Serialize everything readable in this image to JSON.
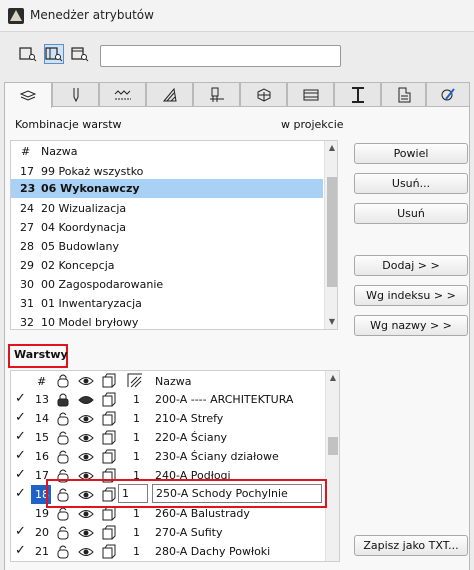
{
  "window": {
    "title": "Menedżer atrybutów"
  },
  "toolbar": {
    "buttons": [
      {
        "icon": "list-view-search-icon",
        "active": false
      },
      {
        "icon": "split-view-search-icon",
        "active": true
      },
      {
        "icon": "single-view-search-icon",
        "active": false
      }
    ],
    "search_value": ""
  },
  "tabs": [
    {
      "icon": "layers-tab-icon",
      "active": true
    },
    {
      "icon": "pens-tab-icon",
      "active": false
    },
    {
      "icon": "line-types-tab-icon",
      "active": false
    },
    {
      "icon": "fills-tab-icon",
      "active": false
    },
    {
      "icon": "surfaces-tab-icon",
      "active": false
    },
    {
      "icon": "building-materials-tab-icon",
      "active": false
    },
    {
      "icon": "composites-tab-icon",
      "active": false
    },
    {
      "icon": "profiles-tab-icon",
      "active": false
    },
    {
      "icon": "zone-categories-tab-icon",
      "active": false
    },
    {
      "icon": "markup-styles-tab-icon",
      "active": false
    }
  ],
  "combinations": {
    "title": "Kombinacje warstw",
    "projection_label": "w projekcie",
    "header": {
      "num": "#",
      "name": "Nazwa"
    },
    "rows": [
      {
        "num": "17",
        "name": "99 Pokaż wszystko",
        "selected": false
      },
      {
        "num": "23",
        "name": "06 Wykonawczy",
        "selected": true
      },
      {
        "num": "24",
        "name": "20 Wizualizacja",
        "selected": false
      },
      {
        "num": "27",
        "name": "04 Koordynacja",
        "selected": false
      },
      {
        "num": "28",
        "name": "05 Budowlany",
        "selected": false
      },
      {
        "num": "29",
        "name": "02 Koncepcja",
        "selected": false
      },
      {
        "num": "30",
        "name": "00 Zagospodarowanie",
        "selected": false
      },
      {
        "num": "31",
        "name": "01 Inwentaryzacja",
        "selected": false
      },
      {
        "num": "32",
        "name": "10 Model bryłowy",
        "selected": false
      }
    ]
  },
  "buttons": {
    "recall": "Powiel",
    "delete_dots": "Usuń...",
    "delete": "Usuń",
    "add": "Dodaj > >",
    "by_index": "Wg indeksu > >",
    "by_name": "Wg nazwy > >",
    "save_txt": "Zapisz jako TXT..."
  },
  "layers": {
    "title": "Warstwy",
    "header": {
      "num": "#",
      "name": "Nazwa"
    },
    "rows": [
      {
        "checked": true,
        "num": "13",
        "lock": "locked",
        "vis": "hidden",
        "wire": "solid",
        "isect": "1",
        "name": "200-A ---- ARCHITEKTURA",
        "selected": false
      },
      {
        "checked": true,
        "num": "14",
        "lock": "unlocked",
        "vis": "shown",
        "wire": "solid",
        "isect": "1",
        "name": "210-A Strefy",
        "selected": false
      },
      {
        "checked": true,
        "num": "15",
        "lock": "unlocked",
        "vis": "shown",
        "wire": "solid",
        "isect": "1",
        "name": "220-A Ściany",
        "selected": false
      },
      {
        "checked": true,
        "num": "16",
        "lock": "unlocked",
        "vis": "shown",
        "wire": "solid",
        "isect": "1",
        "name": "230-A Ściany działowe",
        "selected": false
      },
      {
        "checked": true,
        "num": "17",
        "lock": "unlocked",
        "vis": "shown",
        "wire": "solid",
        "isect": "1",
        "name": "240-A Podłogi",
        "selected": false
      },
      {
        "checked": true,
        "num": "18",
        "lock": "unlocked",
        "vis": "shown",
        "wire": "solid",
        "isect": "1",
        "name": "250-A Schody Pochylnie",
        "selected": true
      },
      {
        "checked": false,
        "num": "19",
        "lock": "unlocked",
        "vis": "shown",
        "wire": "solid",
        "isect": "1",
        "name": "260-A Balustrady",
        "selected": false
      },
      {
        "checked": true,
        "num": "20",
        "lock": "unlocked",
        "vis": "shown",
        "wire": "solid",
        "isect": "1",
        "name": "270-A Sufity",
        "selected": false
      },
      {
        "checked": true,
        "num": "21",
        "lock": "unlocked",
        "vis": "shown",
        "wire": "solid",
        "isect": "1",
        "name": "280-A Dachy Powłoki",
        "selected": false
      }
    ]
  }
}
